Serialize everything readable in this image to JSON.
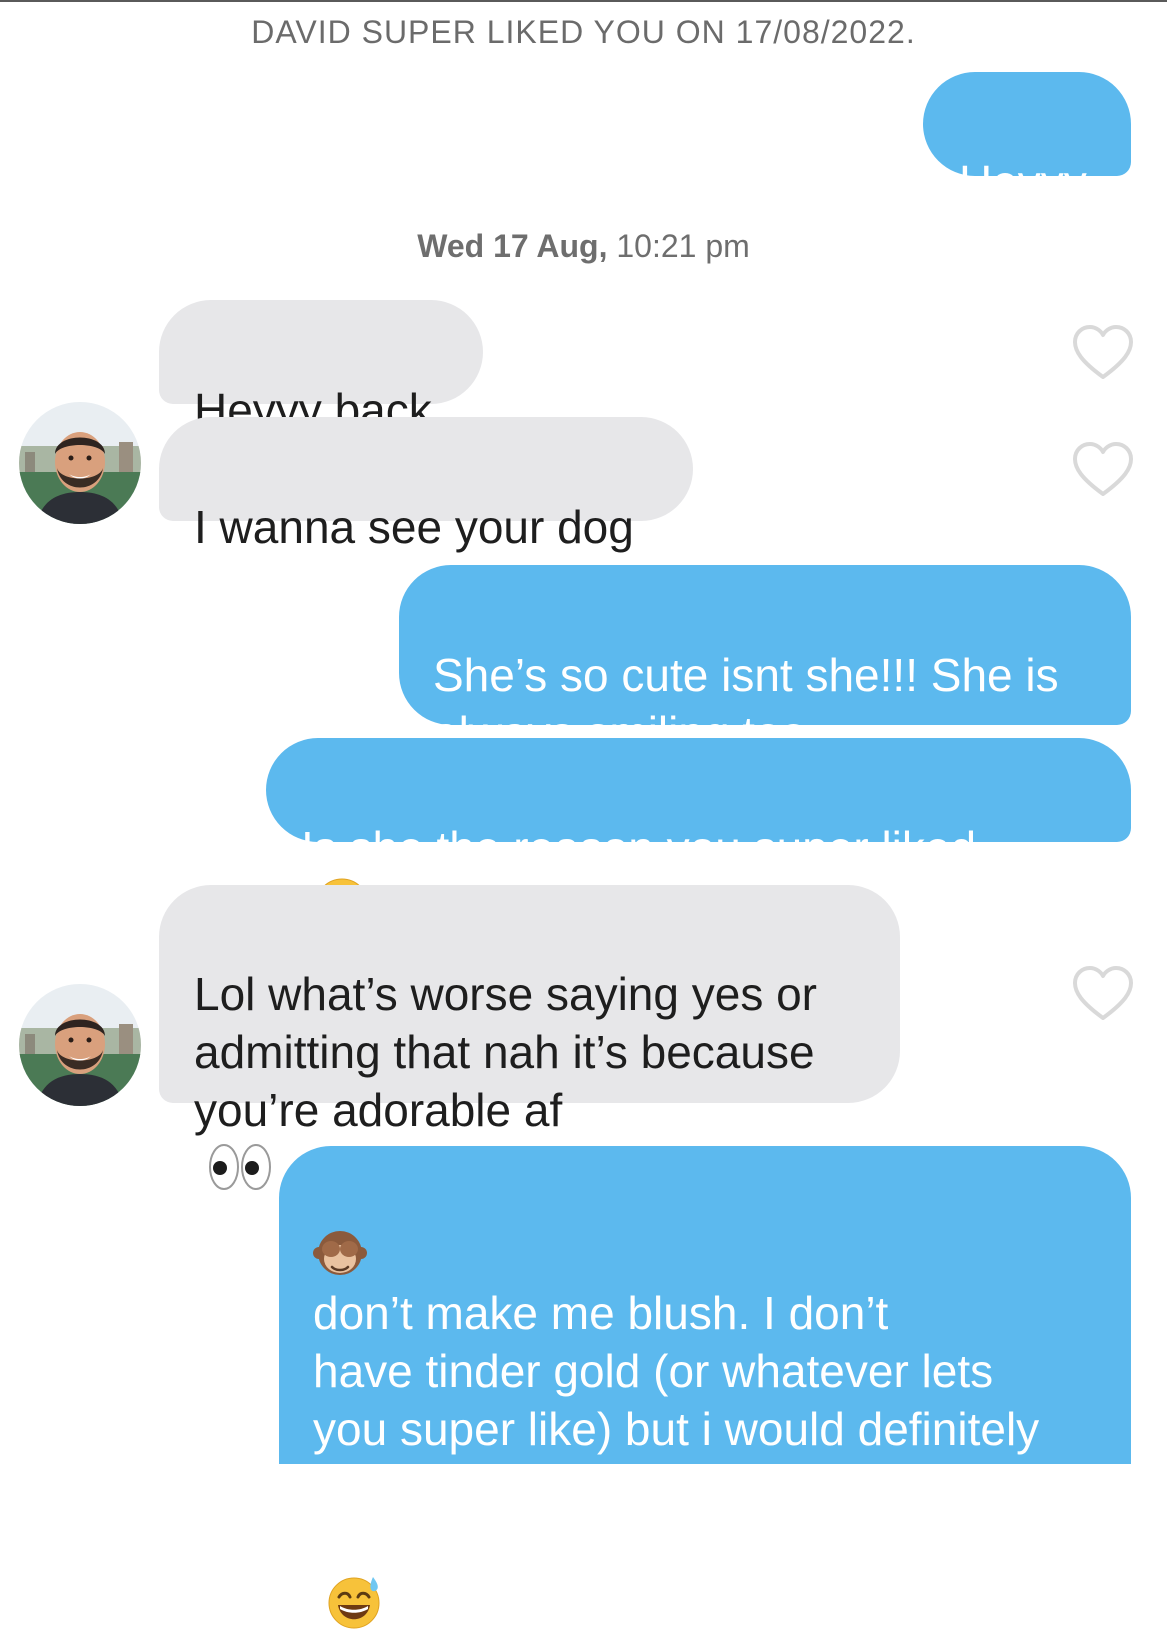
{
  "system_note": "DAVID SUPER LIKED YOU ON 17/08/2022.",
  "timestamp": {
    "date": "Wed 17 Aug,",
    "time": "10:21 pm"
  },
  "messages": [
    {
      "from": "me",
      "text": "Heyyy"
    },
    {
      "from": "David",
      "text": "Heyyy back"
    },
    {
      "from": "David",
      "text": "I wanna see your dog"
    },
    {
      "from": "me",
      "text": "She’s so cute isnt she!!! She is\nalways smiling too"
    },
    {
      "from": "me",
      "text": "Is she the reason you super liked",
      "trailing_emoji": "laughing-squint-emoji"
    },
    {
      "from": "David",
      "text": "Lol what’s worse saying yes or\nadmitting that nah it’s because\nyou’re adorable af",
      "trailing_emoji": "eyes-emoji"
    },
    {
      "from": "me",
      "leading_emoji": "see-no-evil-monkey-emoji",
      "text": " don’t make me blush. I don’t\nhave tinder gold (or whatever lets\nyou super like) but i would definitely\nhave super liked you, you are really\nattractive",
      "trailing_emoji": "sweat-smile-emoji"
    }
  ],
  "colors": {
    "sent_bubble": "#5cb9ee",
    "received_bubble": "#e7e7e9",
    "heart_outline": "#d9d9d9"
  },
  "icons": {
    "like": "heart-outline-icon",
    "avatar": "profile-photo"
  }
}
